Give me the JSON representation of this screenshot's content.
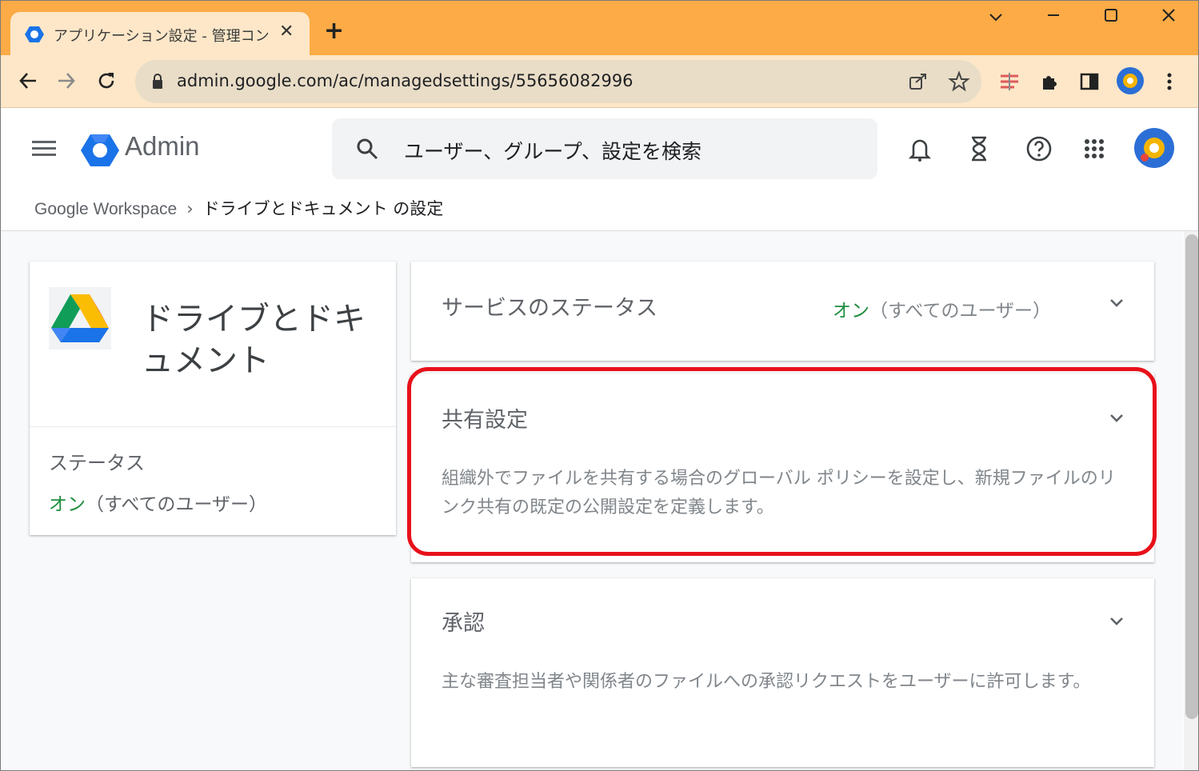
{
  "browser": {
    "tab_title": "アプリケーション設定 - 管理コンソール",
    "new_tab": "+",
    "url": "admin.google.com/ac/managedsettings/55656082996"
  },
  "header": {
    "brand": "Admin",
    "search_placeholder": "ユーザー、グループ、設定を検索"
  },
  "breadcrumb": {
    "root": "Google Workspace",
    "separator": "›",
    "current": "ドライブとドキュメント の設定"
  },
  "app_card": {
    "title": "ドライブとドキュメント",
    "status_label": "ステータス",
    "status_on": "オン",
    "status_scope": "（すべてのユーザー）"
  },
  "sections": [
    {
      "title": "サービスのステータス",
      "status_on": "オン",
      "status_scope": "（すべてのユーザー）"
    },
    {
      "title": "共有設定",
      "description": "組織外でファイルを共有する場合のグローバル ポリシーを設定し、新規ファイルのリンク共有の既定の公開設定を定義します。"
    },
    {
      "title": "承認",
      "description": "主な審査担当者や関係者のファイルへの承認リクエストをユーザーに許可します。"
    }
  ],
  "colors": {
    "tabstrip": "#fcab46",
    "toolbar": "#fde7c8",
    "status_on": "#1e8e3e",
    "highlight": "#e8101a"
  }
}
